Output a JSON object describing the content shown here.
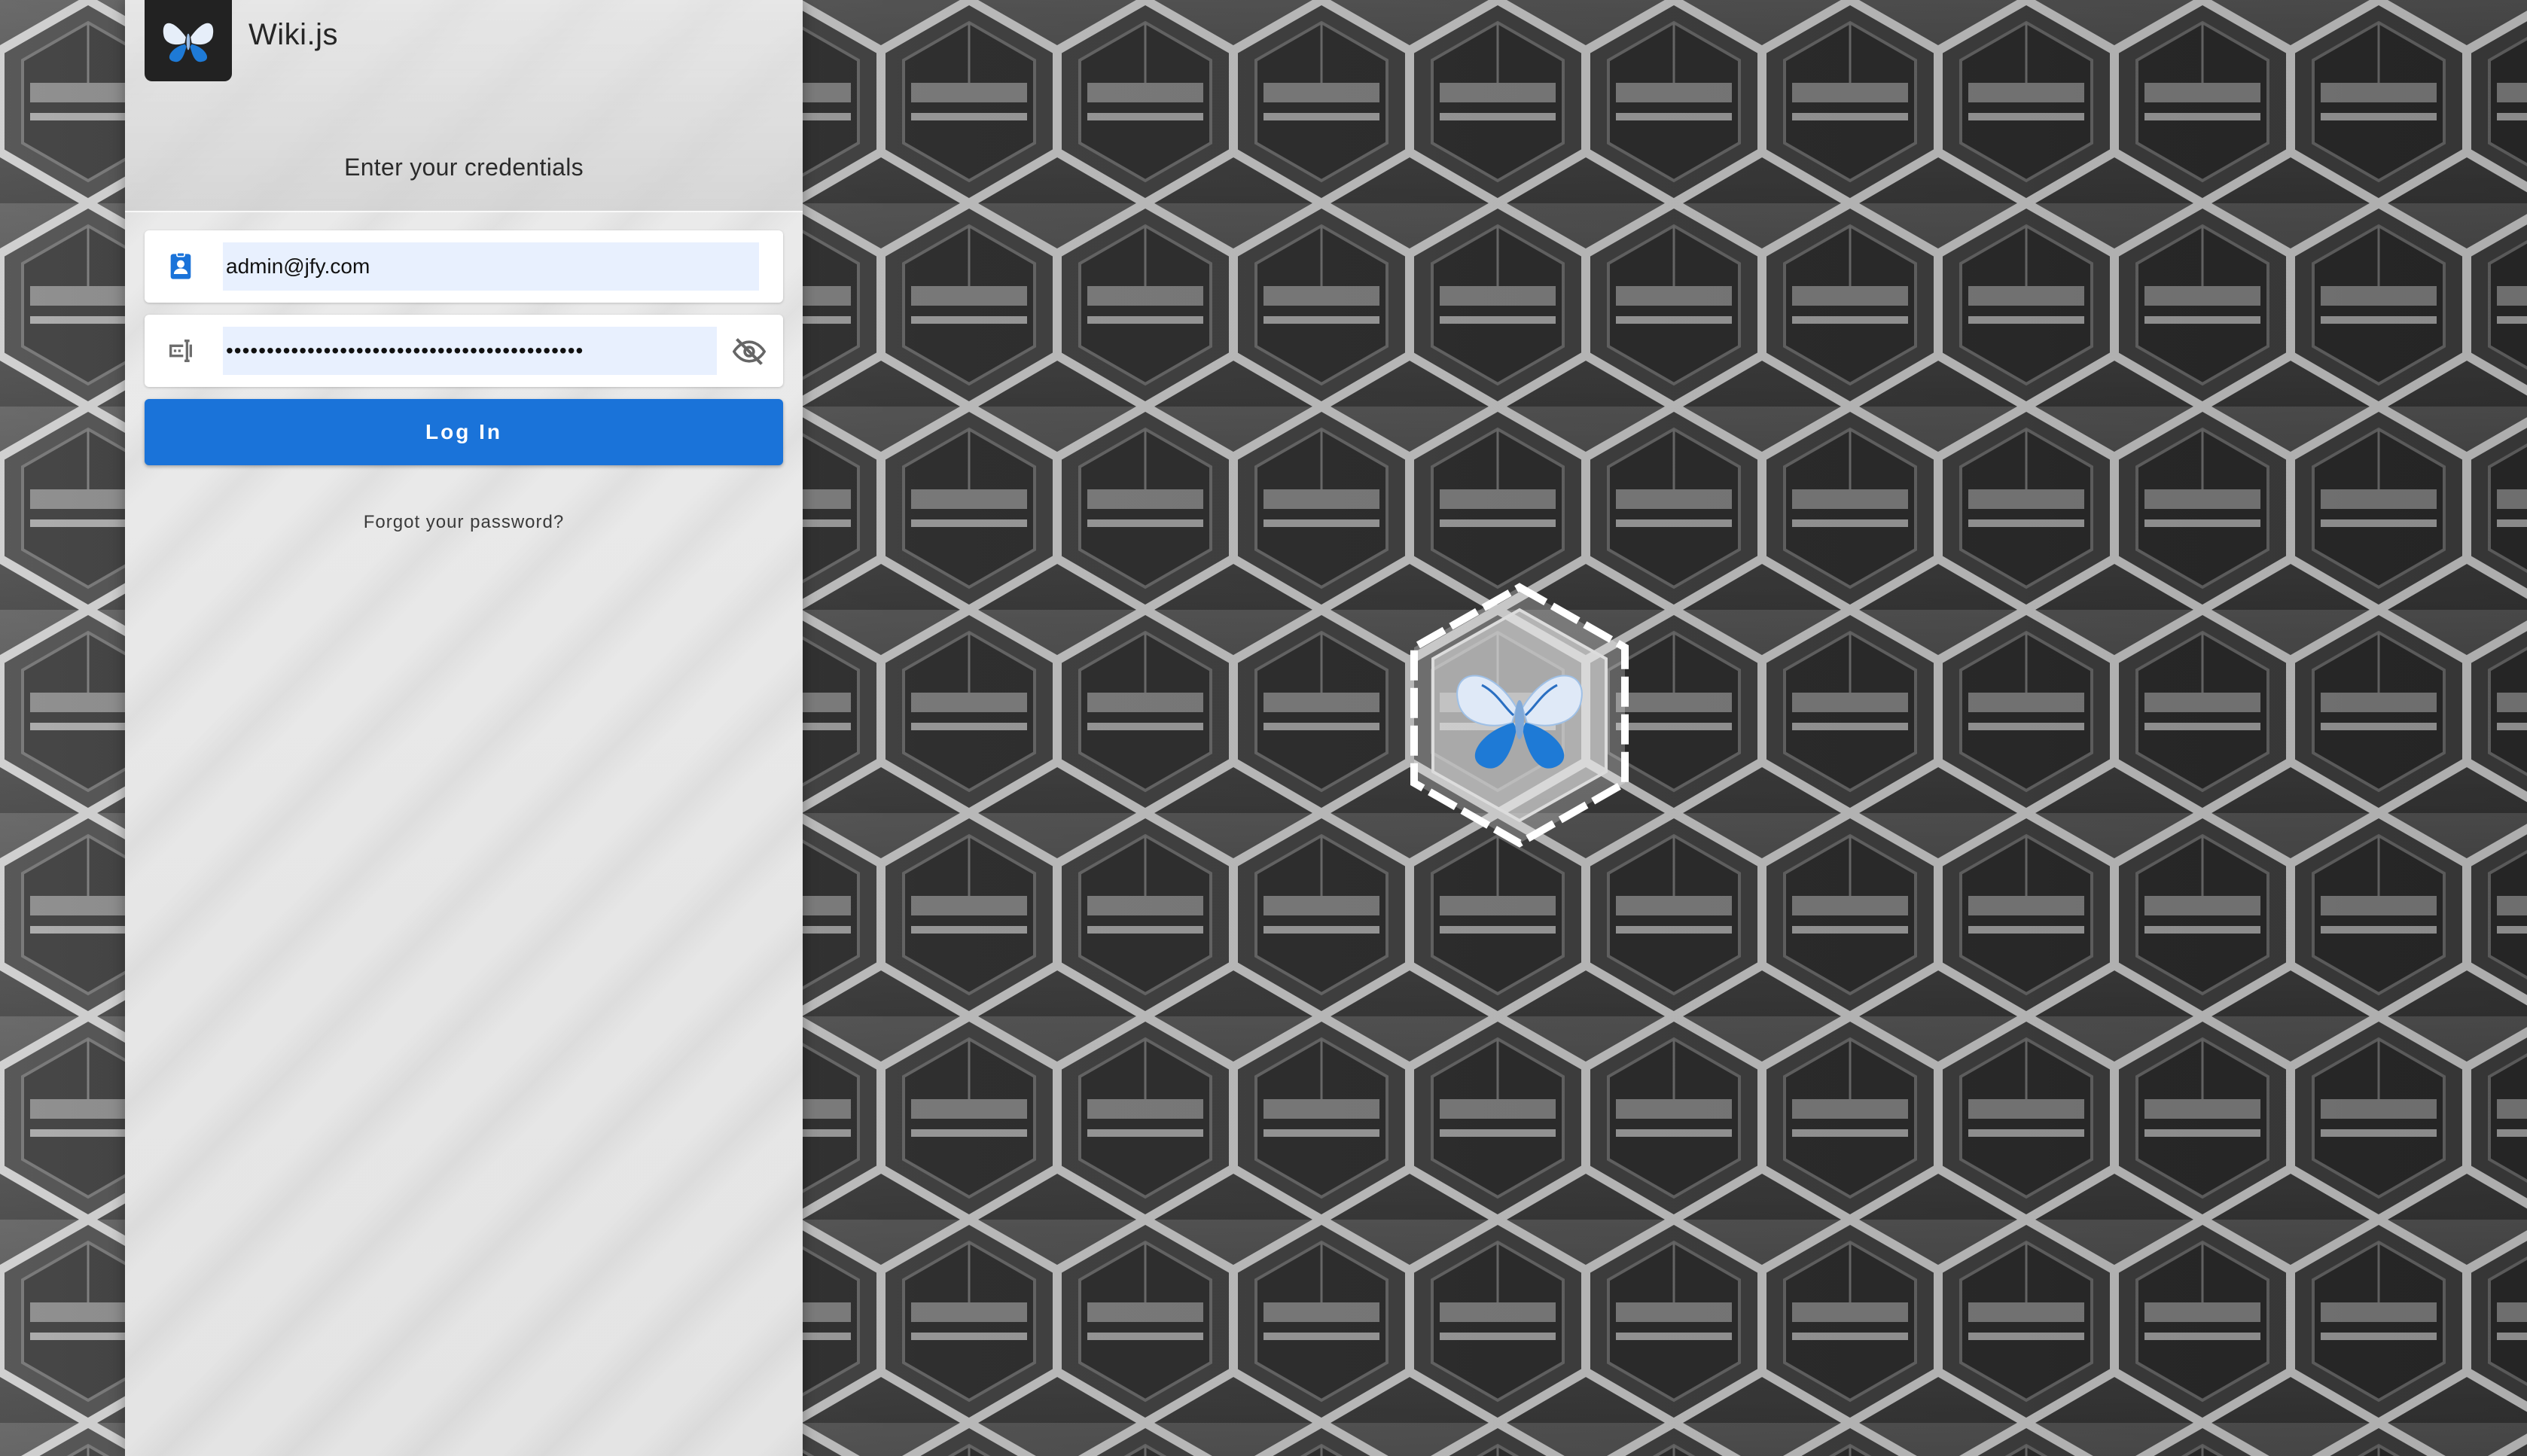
{
  "brand": {
    "name": "Wiki.js",
    "logo_icon": "wikijs-butterfly-icon"
  },
  "login": {
    "subtitle": "Enter your credentials",
    "email_icon": "account-box-icon",
    "email_value": "admin@jfy.com",
    "password_icon": "form-textbox-password-icon",
    "password_value": "••••••••••••••••••••••••••••••••••••••••••••",
    "password_visibility_icon": "eye-off-icon",
    "login_button": "Log In",
    "forgot_link": "Forgot your password?"
  },
  "background": {
    "emblem_icon": "wikijs-butterfly-icon"
  },
  "colors": {
    "accent": "#1a73d9",
    "autofill_bg": "#e8f0fe",
    "logo_bg": "#222222"
  }
}
